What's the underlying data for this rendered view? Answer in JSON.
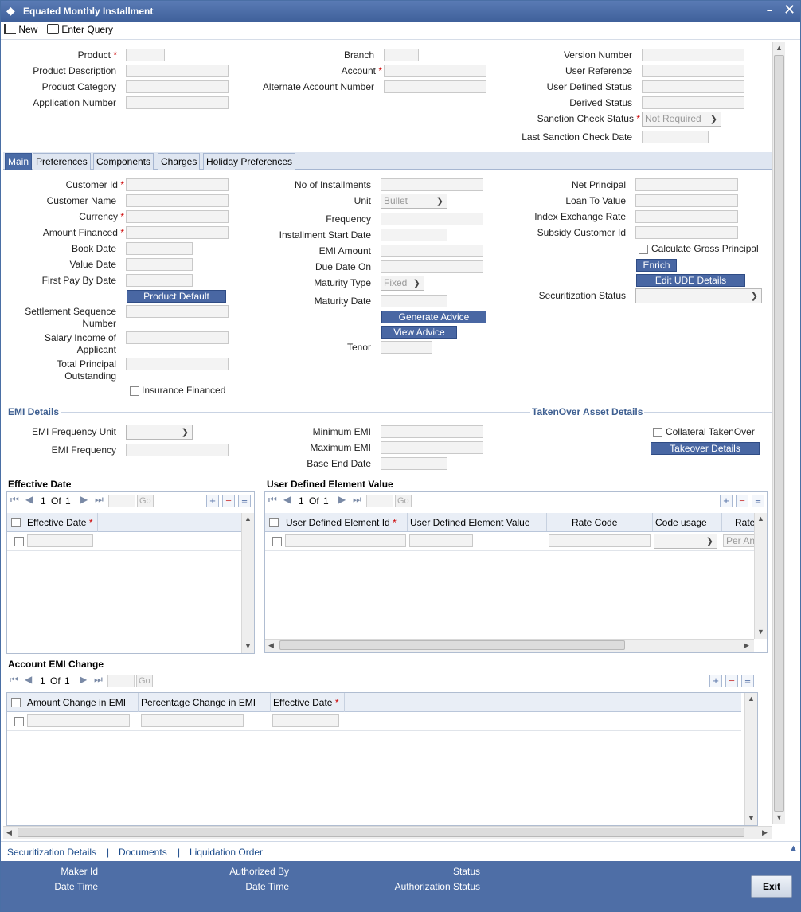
{
  "window": {
    "title": "Equated Monthly Installment"
  },
  "toolbar": {
    "new_label": "New",
    "enter_query_label": "Enter Query"
  },
  "header": {
    "product": "Product",
    "product_description": "Product Description",
    "product_category": "Product Category",
    "application_number": "Application Number",
    "branch": "Branch",
    "account": "Account",
    "alternate_account_number": "Alternate Account Number",
    "version_number": "Version Number",
    "user_reference": "User Reference",
    "user_defined_status": "User Defined Status",
    "derived_status": "Derived Status",
    "sanction_check_status": "Sanction Check Status",
    "sanction_check_value": "Not Required",
    "last_sanction_check_date": "Last Sanction Check Date"
  },
  "tabs": [
    "Main",
    "Preferences",
    "Components",
    "Charges",
    "Holiday Preferences"
  ],
  "main": {
    "customer_id": "Customer Id",
    "customer_name": "Customer Name",
    "currency": "Currency",
    "amount_financed": "Amount Financed",
    "book_date": "Book Date",
    "value_date": "Value Date",
    "first_pay_by_date": "First Pay By Date",
    "product_default": "Product Default",
    "settlement_sequence_number": "Settlement Sequence Number",
    "salary_income": "Salary Income of Applicant",
    "total_principal_outstanding": "Total Principal Outstanding",
    "insurance_financed": "Insurance Financed",
    "no_of_installments": "No of Installments",
    "unit": "Unit",
    "unit_value": "Bullet",
    "frequency": "Frequency",
    "installment_start_date": "Installment Start Date",
    "emi_amount": "EMI Amount",
    "due_date_on": "Due Date On",
    "maturity_type": "Maturity Type",
    "maturity_type_value": "Fixed",
    "maturity_date": "Maturity Date",
    "generate_advice": "Generate Advice",
    "view_advice": "View Advice",
    "tenor": "Tenor",
    "net_principal": "Net Principal",
    "loan_to_value": "Loan To Value",
    "index_exchange_rate": "Index Exchange Rate",
    "subsidy_customer_id": "Subsidy Customer Id",
    "calculate_gross_principal": "Calculate Gross Principal",
    "enrich": "Enrich",
    "edit_ude_details": "Edit UDE Details",
    "securitization_status": "Securitization Status"
  },
  "emi_details": {
    "title": "EMI Details",
    "emi_frequency_unit": "EMI Frequency Unit",
    "emi_frequency": "EMI Frequency",
    "minimum_emi": "Minimum EMI",
    "maximum_emi": "Maximum EMI",
    "base_end_date": "Base End Date"
  },
  "takenover": {
    "title": "TakenOver Asset Details",
    "collateral_takenover": "Collateral TakenOver",
    "takeover_details": "Takeover Details"
  },
  "effective_date_grid": {
    "title": "Effective Date",
    "page": "1",
    "of": "Of",
    "total": "1",
    "go": "Go",
    "columns": [
      "Effective Date"
    ]
  },
  "ude_grid": {
    "title": "User Defined Element Value",
    "page": "1",
    "of": "Of",
    "total": "1",
    "go": "Go",
    "columns": [
      "User Defined Element Id",
      "User Defined Element Value",
      "Rate Code",
      "Code usage",
      "Rate"
    ],
    "row_rate_placeholder": "Per An"
  },
  "account_emi_grid": {
    "title": "Account EMI Change",
    "page": "1",
    "of": "Of",
    "total": "1",
    "go": "Go",
    "columns": [
      "Amount Change in EMI",
      "Percentage Change in EMI",
      "Effective Date"
    ]
  },
  "footer": {
    "links": [
      "Securitization Details",
      "Documents",
      "Liquidation Order"
    ],
    "separator": "|",
    "maker_id": "Maker Id",
    "date_time": "Date Time",
    "authorized_by": "Authorized By",
    "status": "Status",
    "authorization_status": "Authorization Status",
    "exit": "Exit"
  },
  "colors": {
    "accent": "#4a6ba6",
    "required": "#cc0000",
    "link": "#1a4a8a"
  }
}
